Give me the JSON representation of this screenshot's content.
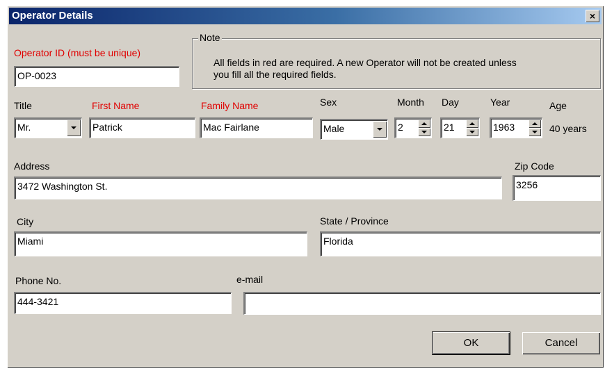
{
  "window": {
    "title": "Operator Details",
    "close_label": "×"
  },
  "operator_id": {
    "label": "Operator ID (must be unique)",
    "value": "OP-0023"
  },
  "note": {
    "title": "Note",
    "line1": "All fields in red are required. A new Operator will not be created unless",
    "line2": "you fill all the required fields."
  },
  "title_field": {
    "label": "Title",
    "value": "Mr."
  },
  "first_name": {
    "label": "First Name",
    "value": "Patrick"
  },
  "family_name": {
    "label": "Family Name",
    "value": "Mac Fairlane"
  },
  "sex": {
    "label": "Sex",
    "value": "Male"
  },
  "month": {
    "label": "Month",
    "value": "2"
  },
  "day": {
    "label": "Day",
    "value": "21"
  },
  "year": {
    "label": "Year",
    "value": "1963"
  },
  "age": {
    "label": "Age",
    "value": "40 years"
  },
  "address": {
    "label": "Address",
    "value": "3472 Washington St."
  },
  "zip": {
    "label": "Zip Code",
    "value": "3256"
  },
  "city": {
    "label": "City",
    "value": "Miami"
  },
  "state": {
    "label": "State / Province",
    "value": "Florida"
  },
  "phone": {
    "label": "Phone No.",
    "value": "444-3421"
  },
  "email": {
    "label": "e-mail",
    "value": ""
  },
  "buttons": {
    "ok": "OK",
    "cancel": "Cancel"
  },
  "colors": {
    "required": "#e00000",
    "dialog_bg": "#d4d0c8",
    "title_bar": "#0a246a"
  }
}
